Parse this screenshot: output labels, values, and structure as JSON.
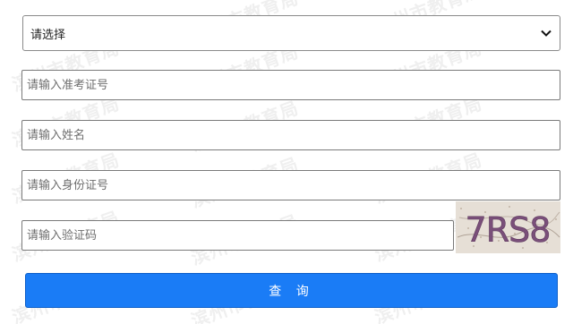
{
  "watermark_text": "滨州市教育局",
  "form": {
    "select": {
      "selected": "请选择"
    },
    "exam_number_placeholder": "请输入准考证号",
    "name_placeholder": "请输入姓名",
    "id_number_placeholder": "请输入身份证号",
    "captcha_placeholder": "请输入验证码",
    "captcha_text": "7RS8",
    "submit_label": "查 询"
  },
  "colors": {
    "button_bg": "#1a7cf6",
    "captcha_text": "#7a4f7a"
  }
}
